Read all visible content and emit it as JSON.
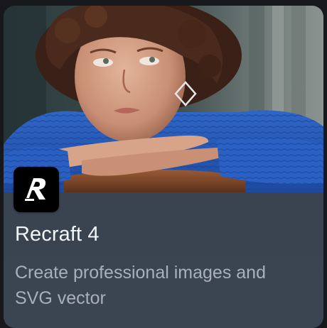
{
  "card": {
    "title": "Recraft 4",
    "description": "Create professional images and SVG vector",
    "logo_icon": "recraft-logo-icon",
    "hero_image_icon": "portrait-photo",
    "colors": {
      "card_background": "#3d4652",
      "title_text": "#f4f5f7",
      "description_text": "#a8b0ba",
      "logo_tile": "#000000",
      "sweater_blue": "#2357b8"
    }
  }
}
